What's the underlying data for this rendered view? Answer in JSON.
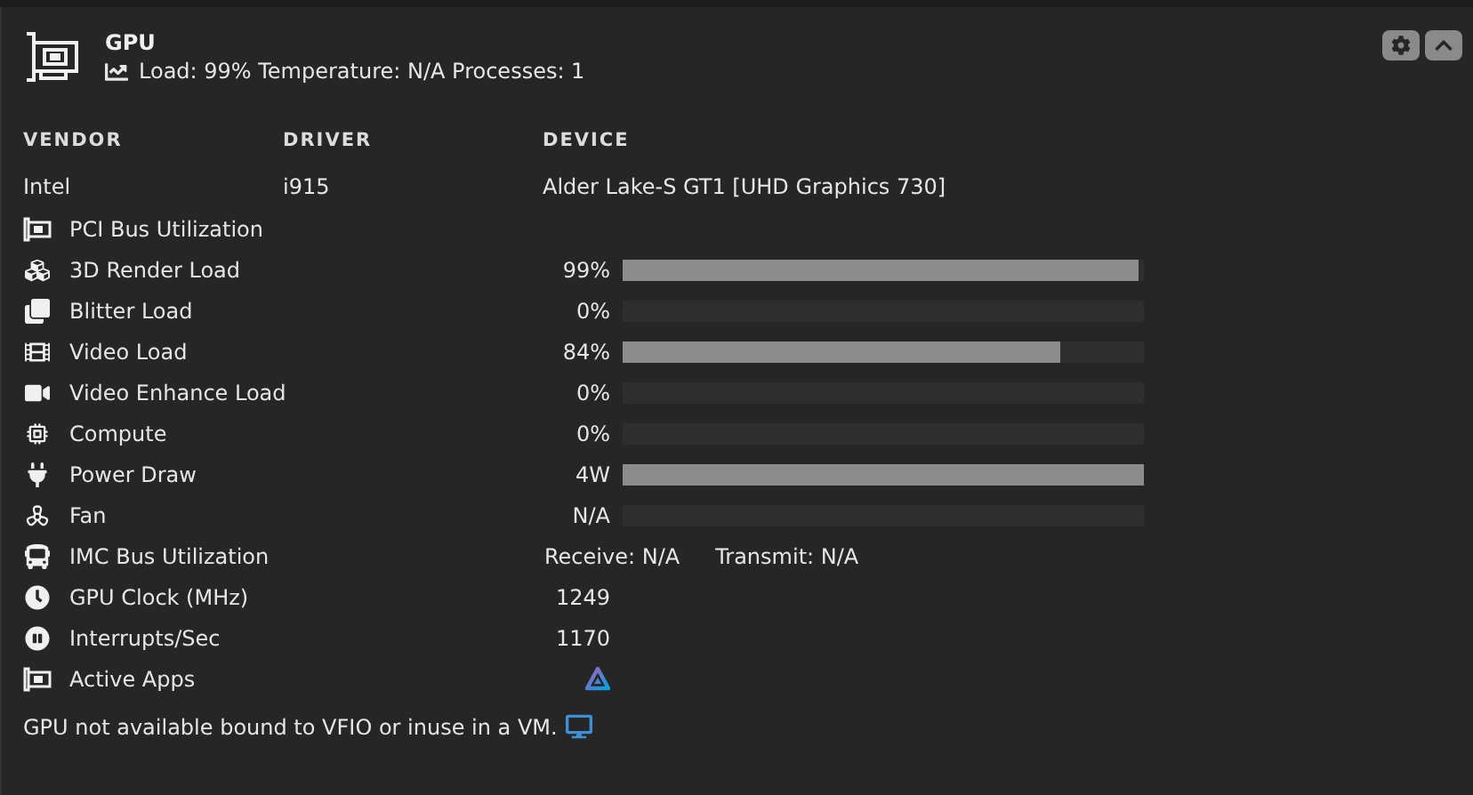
{
  "header": {
    "title": "GPU",
    "summary": "Load: 99% Temperature: N/A Processes: 1"
  },
  "columns": [
    "VENDOR",
    "DRIVER",
    "DEVICE"
  ],
  "device": [
    "Intel",
    "i915",
    "Alder Lake-S GT1 [UHD Graphics 730]"
  ],
  "metrics": [
    {
      "kind": "none",
      "label": "PCI Bus Utilization"
    },
    {
      "kind": "bar",
      "label": "3D Render Load",
      "value": "99%",
      "level": 0.99
    },
    {
      "kind": "bar",
      "label": "Blitter Load",
      "value": "0%",
      "level": 0
    },
    {
      "kind": "bar",
      "label": "Video Load",
      "value": "84%",
      "level": 0.84
    },
    {
      "kind": "bar",
      "label": "Video Enhance Load",
      "value": "0%",
      "level": 0
    },
    {
      "kind": "bar",
      "label": "Compute",
      "value": "0%",
      "level": 0
    },
    {
      "kind": "bar",
      "label": "Power Draw",
      "value": "4W",
      "level": 1
    },
    {
      "kind": "bar",
      "label": "Fan",
      "value": "N/A",
      "level": 0
    },
    {
      "kind": "transfer",
      "label": "IMC Bus Utilization",
      "receive": "Receive: N/A",
      "transmit": "Transmit: N/A"
    },
    {
      "kind": "text",
      "label": "GPU Clock (MHz)",
      "value": "1249"
    },
    {
      "kind": "text",
      "label": "Interrupts/Sec",
      "value": "1170"
    },
    {
      "kind": "app",
      "label": "Active Apps"
    }
  ],
  "footer": "GPU not available bound to VFIO or inuse in a VM."
}
